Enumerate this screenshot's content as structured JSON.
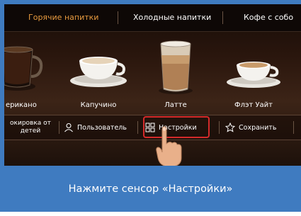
{
  "tabs": [
    {
      "label": "Горячие напитки",
      "active": true
    },
    {
      "label": "Холодные напитки",
      "active": false
    },
    {
      "label": "Кофе с собо",
      "active": false
    }
  ],
  "drinks": [
    {
      "label": "ерикано",
      "icon": "americano-glass-icon"
    },
    {
      "label": "Капучино",
      "icon": "cappuccino-cup-icon"
    },
    {
      "label": "Латте",
      "icon": "latte-glass-icon"
    },
    {
      "label": "Флэт Уайт",
      "icon": "flat-white-cup-icon"
    }
  ],
  "toolbar": {
    "lock_line1": "окировка от",
    "lock_line2": "детей",
    "user_label": "Пользователь",
    "settings_label": "Настройки",
    "save_label": "Сохранить"
  },
  "caption": "Нажмите сенсор «Настройки»",
  "colors": {
    "active_tab": "#e79a3f",
    "highlight": "#d42a2a",
    "caption_bar": "#3f7bc0"
  }
}
